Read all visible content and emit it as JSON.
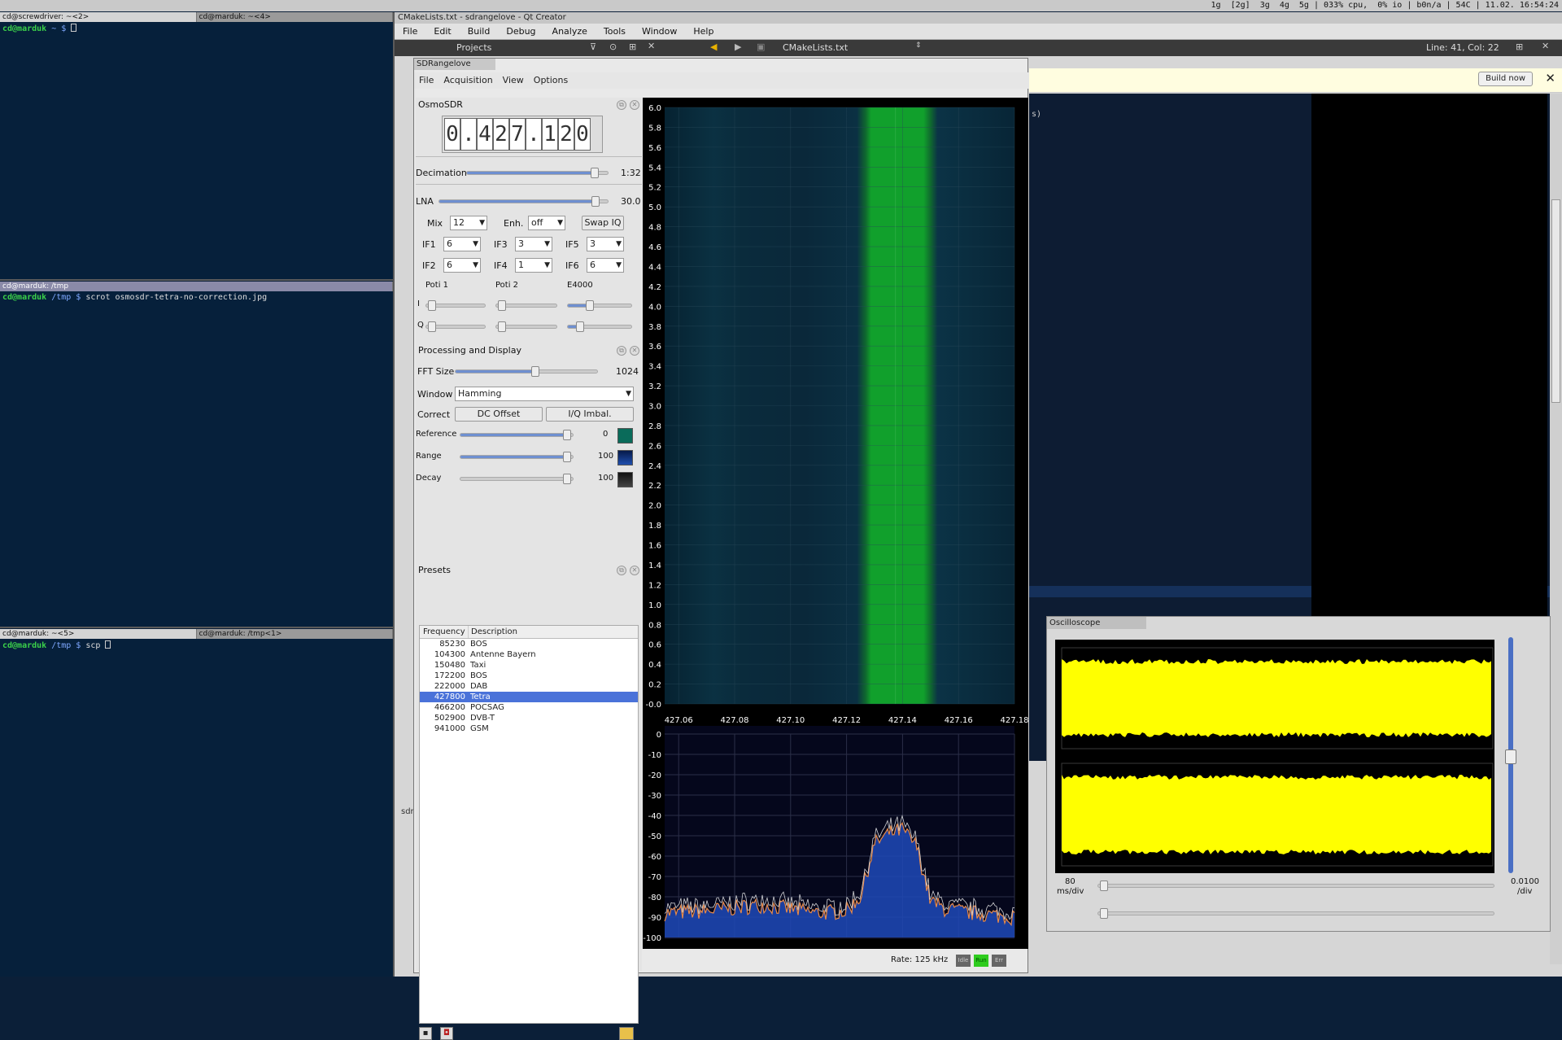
{
  "statusbar": {
    "text": "1g  [2g]  3g  4g  5g | 033% cpu,  0% io | b0n/a | 54C | 11.02. 16:54:24"
  },
  "terminals": {
    "top": {
      "tabs": [
        "cd@screwdriver: ~<2>",
        "cd@marduk: ~<4>"
      ],
      "prompt_user": "cd@marduk",
      "prompt_dir": " ~ $ ",
      "command": ""
    },
    "middle": {
      "tabs": [
        "cd@marduk: /tmp"
      ],
      "prompt_user": "cd@marduk",
      "prompt_dir": " /tmp $ ",
      "command": "scrot osmosdr-tetra-no-correction.jpg"
    },
    "bottom": {
      "tabs": [
        "cd@marduk: ~<5>",
        "cd@marduk: /tmp<1>"
      ],
      "prompt_user": "cd@marduk",
      "prompt_dir": " /tmp $ ",
      "command": "scp "
    }
  },
  "qtcreator": {
    "title": "CMakeLists.txt - sdrangelove - Qt Creator",
    "menu": [
      "File",
      "Edit",
      "Build",
      "Debug",
      "Analyze",
      "Tools",
      "Window",
      "Help"
    ],
    "projects_label": "Projects",
    "file_label": "CMakeLists.txt",
    "cursor_pos": "Line: 41, Col: 22",
    "build_now": "Build now",
    "fragment_s": "s)",
    "fragment_sdr": "sdr",
    "partial_project": "angelove"
  },
  "sdr": {
    "title": "SDRangelove",
    "menu": [
      "File",
      "Acquisition",
      "View",
      "Options"
    ],
    "osmosdr": {
      "title": "OsmoSDR",
      "digits": [
        "0",
        ".",
        "4",
        "2",
        "7",
        ".",
        "1",
        "2",
        "0"
      ],
      "decimation_label": "Decimation",
      "decimation_value": "1:32",
      "lna_label": "LNA",
      "lna_value": "30.0",
      "mix_label": "Mix",
      "mix_value": "12",
      "enh_label": "Enh.",
      "enh_value": "off",
      "swapiq": "Swap IQ",
      "if": [
        {
          "label": "IF1",
          "value": "6"
        },
        {
          "label": "IF3",
          "value": "3"
        },
        {
          "label": "IF5",
          "value": "3"
        },
        {
          "label": "IF2",
          "value": "6"
        },
        {
          "label": "IF4",
          "value": "1"
        },
        {
          "label": "IF6",
          "value": "6"
        }
      ],
      "poti1": "Poti 1",
      "poti2": "Poti 2",
      "e4000": "E4000",
      "i_label": "I",
      "q_label": "Q"
    },
    "processing": {
      "title": "Processing and Display",
      "fft_label": "FFT Size",
      "fft_value": "1024",
      "window_label": "Window",
      "window_value": "Hamming",
      "correct_label": "Correct",
      "dc_offset": "DC Offset",
      "iq_imbal": "I/Q Imbal.",
      "reference_label": "Reference",
      "reference_value": "0",
      "range_label": "Range",
      "range_value": "100",
      "decay_label": "Decay",
      "decay_value": "100"
    },
    "presets": {
      "title": "Presets",
      "headers": [
        "Frequency",
        "Description"
      ],
      "rows": [
        {
          "freq": "85230",
          "desc": "BOS"
        },
        {
          "freq": "104300",
          "desc": "Antenne Bayern"
        },
        {
          "freq": "150480",
          "desc": "Taxi"
        },
        {
          "freq": "172200",
          "desc": "BOS"
        },
        {
          "freq": "222000",
          "desc": "DAB"
        },
        {
          "freq": "427800",
          "desc": "Tetra"
        },
        {
          "freq": "466200",
          "desc": "POCSAG"
        },
        {
          "freq": "502900",
          "desc": "DVB-T"
        },
        {
          "freq": "941000",
          "desc": "GSM"
        }
      ],
      "selected_index": 5
    },
    "status": {
      "rate": "Rate: 125 kHz",
      "idle": "Idle",
      "run": "Run",
      "err": "Err"
    }
  },
  "chart_data": [
    {
      "type": "heatmap",
      "y_ticks": [
        "6.0",
        "5.8",
        "5.6",
        "5.4",
        "5.2",
        "5.0",
        "4.8",
        "4.6",
        "4.4",
        "4.2",
        "4.0",
        "3.8",
        "3.6",
        "3.4",
        "3.2",
        "3.0",
        "2.8",
        "2.6",
        "2.4",
        "2.2",
        "2.0",
        "1.8",
        "1.6",
        "1.4",
        "1.2",
        "1.0",
        "0.8",
        "0.6",
        "0.4",
        "0.2",
        "-0.0"
      ],
      "x_ticks": [
        "427.06",
        "427.08",
        "427.10",
        "427.12",
        "427.14",
        "427.16",
        "427.18"
      ],
      "xlim": [
        427.055,
        427.18
      ],
      "ylim": [
        0,
        6.0
      ],
      "signal_band": [
        427.126,
        427.149
      ]
    },
    {
      "type": "line",
      "y_ticks": [
        "0",
        "-10",
        "-20",
        "-30",
        "-40",
        "-50",
        "-60",
        "-70",
        "-80",
        "-90",
        "-100"
      ],
      "ylim": [
        -100,
        0
      ],
      "xlim": [
        427.055,
        427.18
      ],
      "x": [
        427.055,
        427.07,
        427.09,
        427.11,
        427.12,
        427.125,
        427.13,
        427.135,
        427.14,
        427.145,
        427.15,
        427.155,
        427.165,
        427.18
      ],
      "y": [
        -88,
        -87,
        -84,
        -88,
        -87,
        -80,
        -54,
        -49,
        -47,
        -55,
        -82,
        -86,
        -88,
        -90
      ]
    }
  ],
  "oscilloscope": {
    "title": "Oscilloscope",
    "time_value": "80",
    "time_unit": "ms/div",
    "amp_value": "0.0100",
    "amp_unit": "/div",
    "trace_color": "#ffff00"
  }
}
